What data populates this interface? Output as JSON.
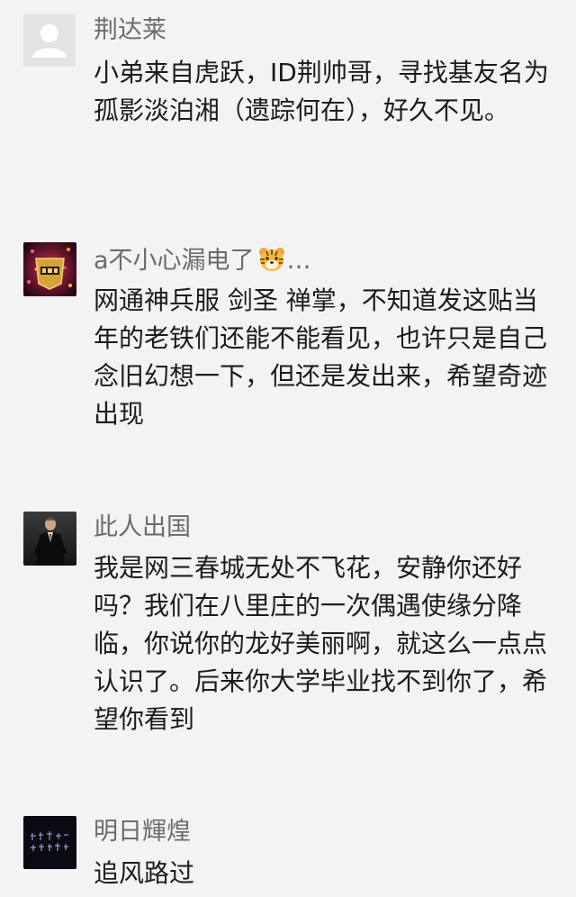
{
  "comments": [
    {
      "author": "荆达莱",
      "avatar": "default-avatar-icon",
      "text": "小弟来自虎跃，ID荆帅哥，寻找基友名为孤影淡泊湘（遗踪何在），好久不见。"
    },
    {
      "author": "a不小心漏电了",
      "author_suffix": "…",
      "avatar": "game-logo-avatar",
      "text": "网通神兵服 剑圣 禅掌，不知道发这贴当年的老铁们还能不能看见，也许只是自己念旧幻想一下，但还是发出来，希望奇迹出现"
    },
    {
      "author": "此人出国",
      "avatar": "man-in-suit-avatar",
      "text": "我是网三春城无处不飞花，安静你还好吗？我们在八里庄的一次偶遇使缘分降临，你说你的龙好美丽啊，就这么一点点认识了。后来你大学毕业找不到你了，希望你看到"
    },
    {
      "author": "明日輝煌",
      "avatar": "dark-calligraphy-avatar",
      "text": "追风路过"
    }
  ],
  "colors": {
    "background": "#f3f3f3",
    "author": "#6b6b6b",
    "text": "#1c1c1c"
  }
}
